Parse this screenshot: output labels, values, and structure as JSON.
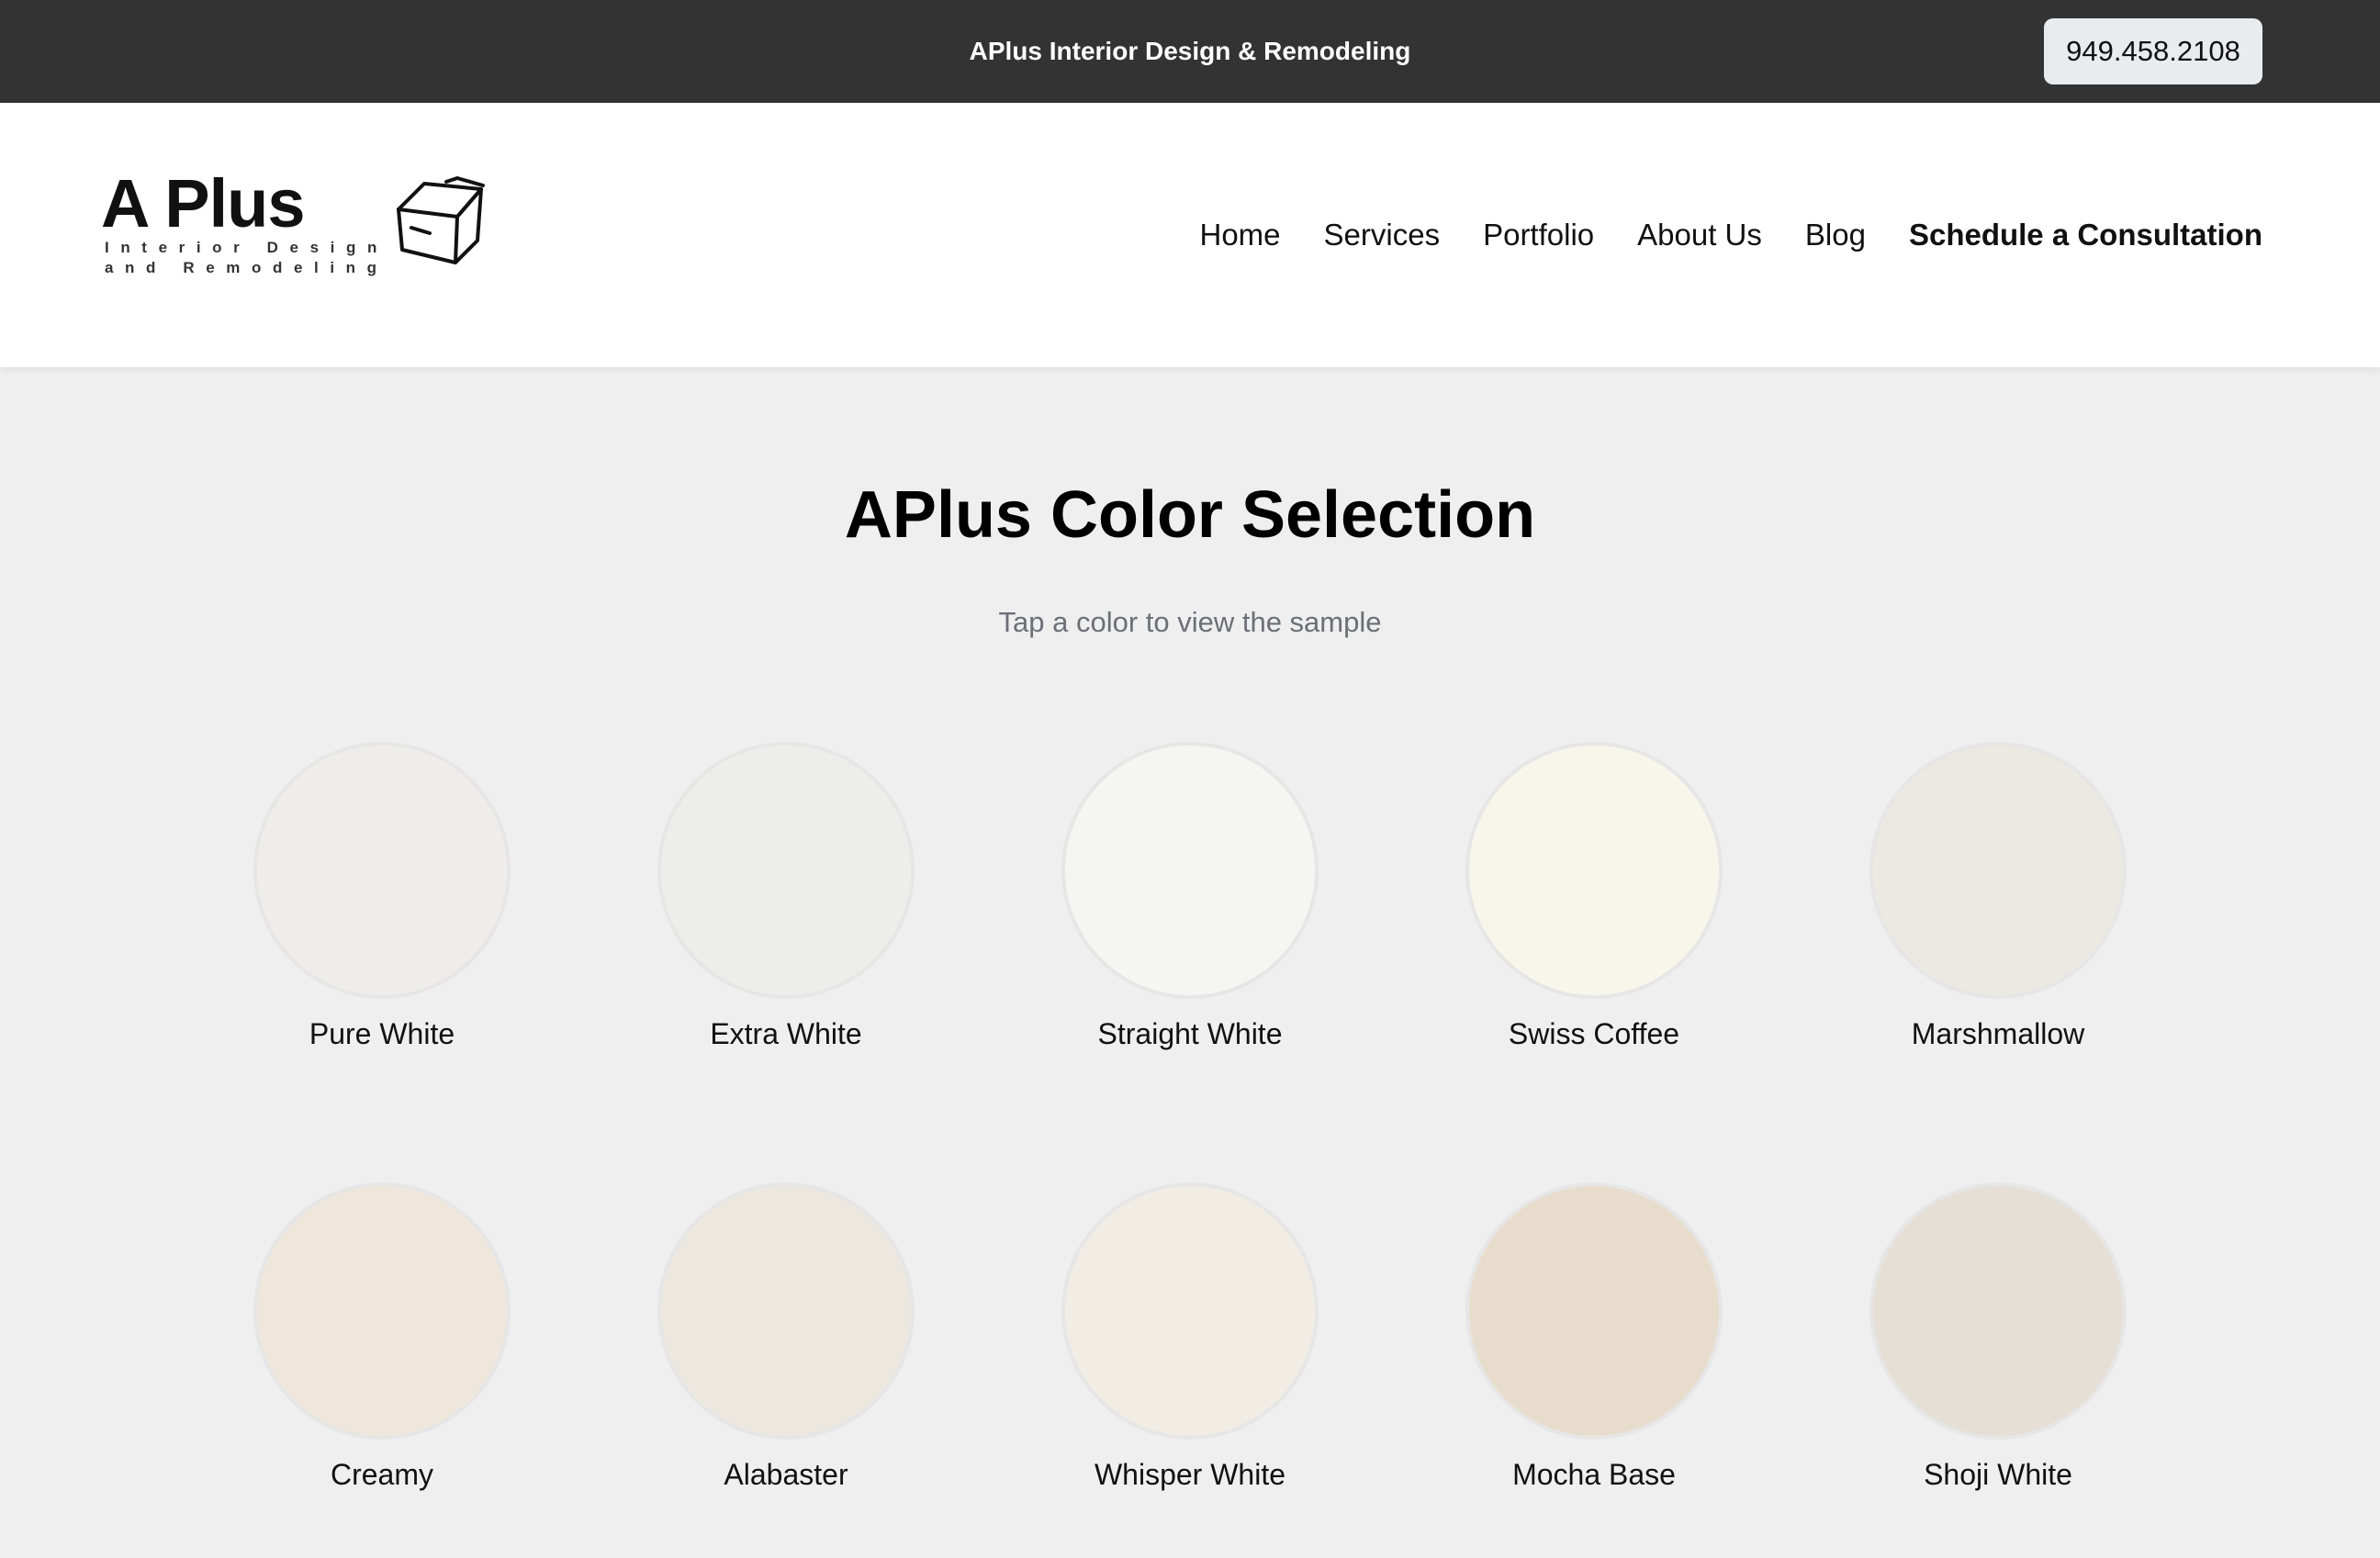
{
  "topbar": {
    "title": "APlus Interior Design & Remodeling",
    "phone": "949.458.2108"
  },
  "logo": {
    "main": "A Plus",
    "line1": "Interior Design",
    "line2": "and Remodeling",
    "icon": "house-outline-icon"
  },
  "nav": {
    "items": [
      "Home",
      "Services",
      "Portfolio",
      "About Us",
      "Blog"
    ],
    "cta": "Schedule a Consultation"
  },
  "main": {
    "title": "APlus Color Selection",
    "subtitle": "Tap a color to view the sample"
  },
  "colors": [
    {
      "name": "Pure White",
      "hex": "#efedea"
    },
    {
      "name": "Extra White",
      "hex": "#edeeeb"
    },
    {
      "name": "Straight White",
      "hex": "#f5f6f1"
    },
    {
      "name": "Swiss Coffee",
      "hex": "#f8f6ea"
    },
    {
      "name": "Marshmallow",
      "hex": "#ece8e2"
    },
    {
      "name": "Creamy",
      "hex": "#f0e7dc"
    },
    {
      "name": "Alabaster",
      "hex": "#ede8df"
    },
    {
      "name": "Whisper White",
      "hex": "#f1ede4"
    },
    {
      "name": "Mocha Base",
      "hex": "#e8dccd"
    },
    {
      "name": "Shoji White",
      "hex": "#e6dfd5"
    }
  ]
}
